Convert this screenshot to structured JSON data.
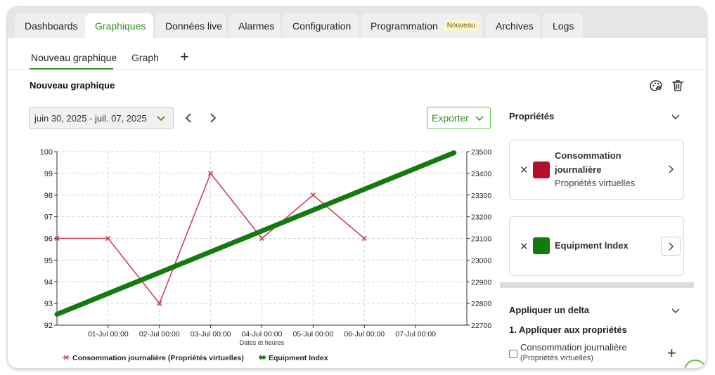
{
  "tabs": [
    {
      "label": "Dashboards",
      "active": false
    },
    {
      "label": "Graphiques",
      "active": true
    },
    {
      "label": "Données live",
      "active": false
    },
    {
      "label": "Alarmes",
      "active": false
    },
    {
      "label": "Configuration",
      "active": false
    },
    {
      "label": "Programmation",
      "active": false,
      "badge": "Nouveau"
    },
    {
      "label": "Archives",
      "active": false
    },
    {
      "label": "Logs",
      "active": false
    }
  ],
  "subtabs": [
    {
      "label": "Nouveau graphique",
      "active": true
    },
    {
      "label": "Graph",
      "active": false
    }
  ],
  "graph": {
    "title": "Nouveau graphique",
    "date_range": "juin 30, 2025 - juil. 07, 2025",
    "export_label": "Exporter"
  },
  "properties": {
    "header": "Propriétés",
    "items": [
      {
        "name_line1": "Consommation",
        "name_line2": "journalière",
        "sub": "Propriétés virtuelles",
        "color": "#b5102a"
      },
      {
        "name_line1": "Equipment Index",
        "sub": "",
        "color": "#137a0f"
      }
    ]
  },
  "delta": {
    "header": "Appliquer un delta",
    "step": "1. Appliquer aux propriétés",
    "option_label": "Consommation journalière",
    "option_sub": "(Propriétés virtuelles)"
  },
  "chart_data": {
    "type": "line",
    "xlabel": "Dates et heures",
    "x_ticks": [
      "01-Jul 00:00",
      "02-Jul 00:00",
      "03-Jul 00:00",
      "04-Jul 00:00",
      "05-Jul 00:00",
      "06-Jul 00:00",
      "07-Jul 00:00"
    ],
    "y_left": {
      "ylim": [
        92,
        100
      ],
      "ticks": [
        92,
        93,
        94,
        95,
        96,
        97,
        98,
        99,
        100
      ]
    },
    "y_right": {
      "ylim": [
        22700,
        23500
      ],
      "ticks": [
        22700,
        22800,
        22900,
        23000,
        23100,
        23200,
        23300,
        23400,
        23500
      ]
    },
    "grid": true,
    "legend_position": "bottom-left",
    "series": [
      {
        "name": "Consommation journalière (Propriétés virtuelles)",
        "axis": "left",
        "color": "#c8435a",
        "points": [
          {
            "x": "30-Jun 00:00",
            "y": 96
          },
          {
            "x": "01-Jul 00:00",
            "y": 96
          },
          {
            "x": "02-Jul 00:00",
            "y": 93
          },
          {
            "x": "03-Jul 00:00",
            "y": 99
          },
          {
            "x": "04-Jul 00:00",
            "y": 96
          },
          {
            "x": "05-Jul 00:00",
            "y": 98
          },
          {
            "x": "06-Jul 00:00",
            "y": 96
          }
        ]
      },
      {
        "name": "Equipment Index",
        "axis": "right",
        "color": "#137a0f",
        "points": [
          {
            "x": "30-Jun 00:00",
            "y": 22750
          },
          {
            "x": "07-Jul 18:00",
            "y": 23495
          }
        ]
      }
    ]
  }
}
